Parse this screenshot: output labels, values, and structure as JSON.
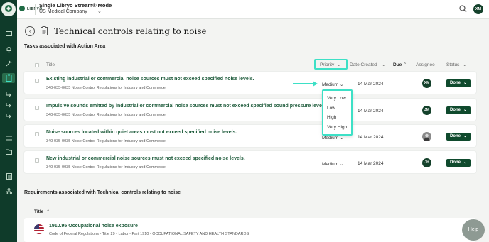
{
  "app": {
    "brand_small": "ERM",
    "brand_name": "LIBRYO",
    "mode": "Single Libryo Stream® Mode",
    "company": "US Medical Company",
    "user_initials": "XM"
  },
  "page": {
    "title": "Technical controls relating to noise"
  },
  "tasks": {
    "heading": "Tasks associated with Action Area",
    "columns": {
      "title": "Title",
      "priority": "Priority",
      "date_created": "Date Created",
      "due": "Due",
      "assignee": "Assignee",
      "status": "Status"
    },
    "rows": [
      {
        "title": "Existing industrial or commercial noise sources must not exceed specified noise levels.",
        "subtitle": "340-035-0035 Noise Control Regulations for Industry and Commerce",
        "priority": "Medium",
        "date": "14 Mar 2024",
        "assignee": "XM",
        "status": "Done"
      },
      {
        "title": "Impulsive sounds emitted by industrial or commercial noise sources must not exceed specified sound pressure levels.",
        "subtitle": "340-035-0035 Noise Control Regulations for Industry and Commerce",
        "priority": "",
        "date": "14 Mar 2024",
        "assignee": "JM",
        "status": "Done"
      },
      {
        "title": "Noise sources located within quiet areas must not exceed specified noise levels.",
        "subtitle": "340-035-0035 Noise Control Regulations for Industry and Commerce",
        "priority": "Medium",
        "date": "14 Mar 2024",
        "assignee": "",
        "status": "Done"
      },
      {
        "title": "New industrial or commercial noise sources must not exceed specified noise levels.",
        "subtitle": "340-035-0035 Noise Control Regulations for Industry and Commerce",
        "priority": "Medium",
        "date": "14 Mar 2024",
        "assignee": "JH",
        "status": "Done"
      }
    ]
  },
  "priority_dropdown": {
    "options": [
      "Very Low",
      "Low",
      "High",
      "Very High"
    ]
  },
  "requirements": {
    "heading": "Requirements associated with Technical controls relating to noise",
    "column_title": "Title",
    "rows": [
      {
        "title": "1910.95 Occupational noise exposure",
        "subtitle": "Code of Federal Regulations - Title 29 - Labor - Part 1910 - OCCUPATIONAL SAFETY AND HEALTH STANDARDS"
      }
    ]
  },
  "help": {
    "label": "Help"
  },
  "colors": {
    "sidebar": "#0f3b2a",
    "accent_green": "#1f5c3c",
    "status_done": "#0f4a2d",
    "highlight": "#3de0c6"
  }
}
